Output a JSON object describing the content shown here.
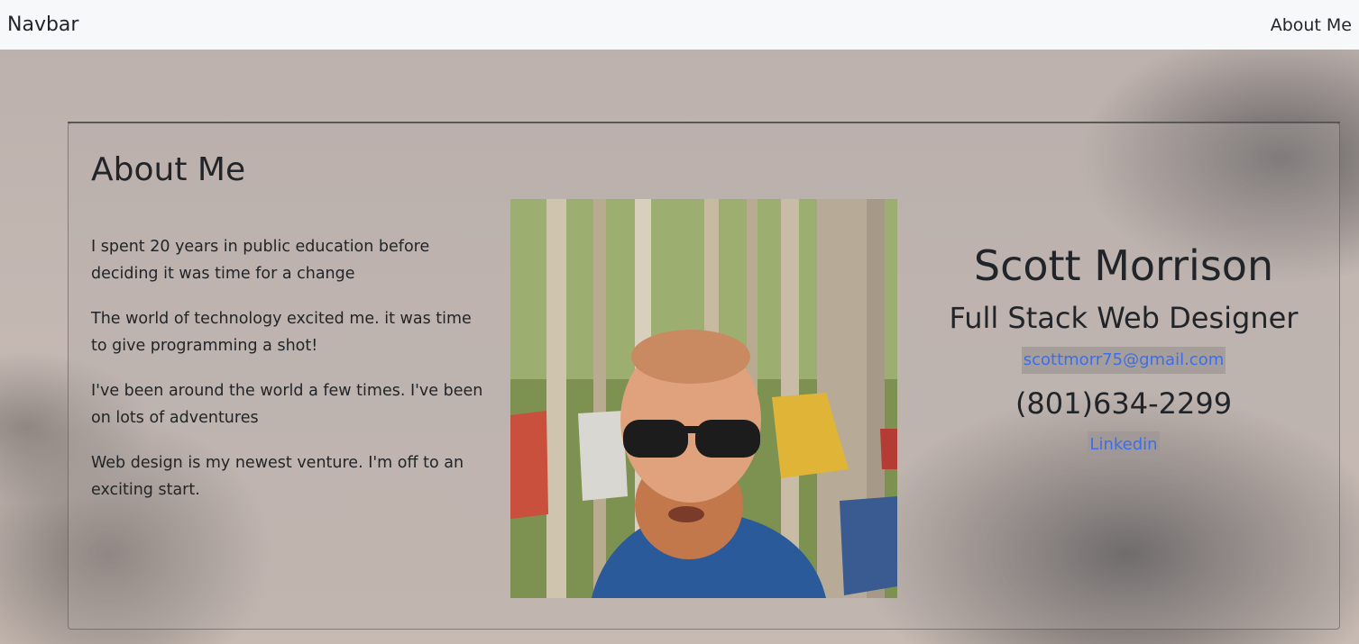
{
  "navbar": {
    "brand": "Navbar",
    "links": [
      "About Me"
    ]
  },
  "about": {
    "title": "About Me",
    "paragraphs": [
      "I spent 20 years in public education before deciding it was time for a change",
      "The world of technology excited me. it was time to give programming a shot!",
      "I've been around the world a few times. I've been on lots of adventures",
      "Web design is my newest venture. I'm off to an exciting start."
    ]
  },
  "contact": {
    "name": "Scott Morrison",
    "role": "Full Stack Web Designer",
    "email": "scottmorr75@gmail.com",
    "phone": "(801)634-2299",
    "linkedin": "Linkedin"
  },
  "colors": {
    "navbar_bg": "#f7f8fa",
    "text": "#212529",
    "link": "#3b6ee8"
  }
}
